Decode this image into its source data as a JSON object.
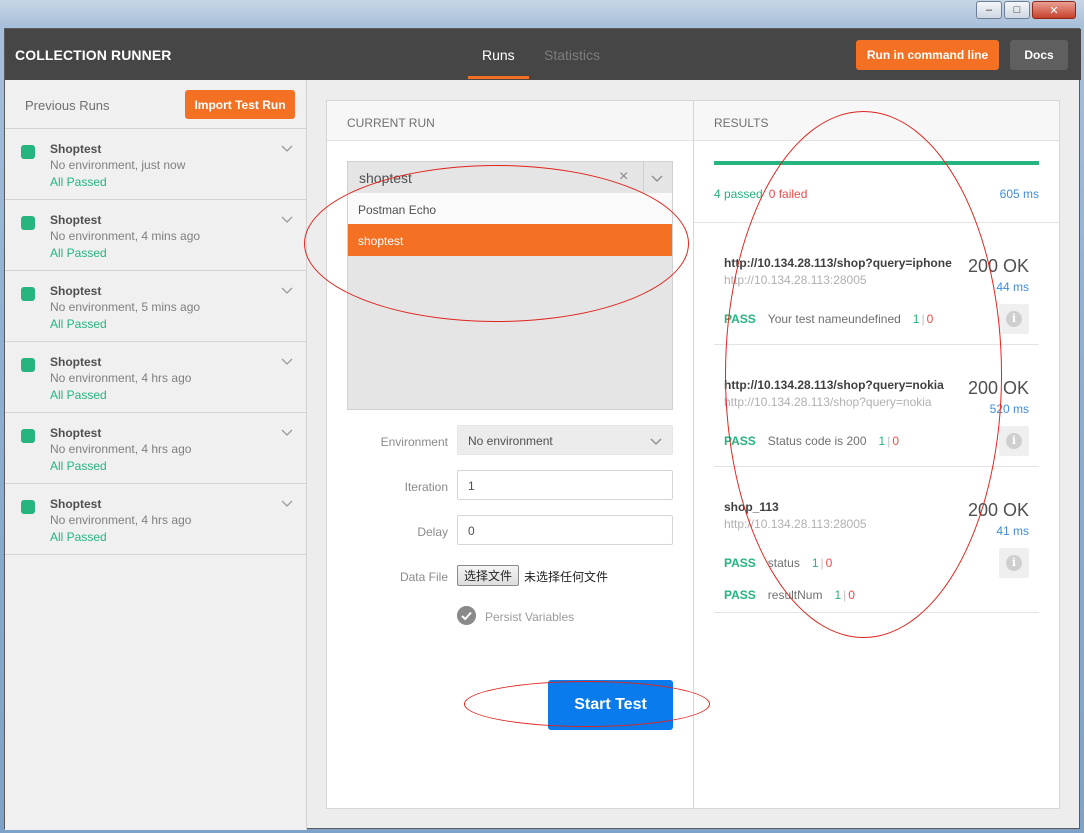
{
  "header": {
    "app_title": "COLLECTION RUNNER",
    "tabs": [
      {
        "label": "Runs",
        "active": true
      },
      {
        "label": "Statistics",
        "active": false
      }
    ],
    "run_cmd_label": "Run in command line",
    "docs_label": "Docs"
  },
  "sidebar": {
    "title": "Previous Runs",
    "import_label": "Import Test Run",
    "runs": [
      {
        "name": "Shoptest",
        "env": "No environment, just now",
        "result": "All Passed"
      },
      {
        "name": "Shoptest",
        "env": "No environment, 4 mins ago",
        "result": "All Passed"
      },
      {
        "name": "Shoptest",
        "env": "No environment, 5 mins ago",
        "result": "All Passed"
      },
      {
        "name": "Shoptest",
        "env": "No environment, 4 hrs ago",
        "result": "All Passed"
      },
      {
        "name": "Shoptest",
        "env": "No environment, 4 hrs ago",
        "result": "All Passed"
      },
      {
        "name": "Shoptest",
        "env": "No environment, 4 hrs ago",
        "result": "All Passed"
      }
    ]
  },
  "current_run": {
    "heading": "CURRENT RUN",
    "collection_value": "shoptest",
    "collection_options": [
      "Postman Echo",
      "shoptest"
    ],
    "environment_label": "Environment",
    "environment_value": "No environment",
    "iteration_label": "Iteration",
    "iteration_value": "1",
    "delay_label": "Delay",
    "delay_value": "0",
    "datafile_label": "Data File",
    "datafile_button": "选择文件",
    "datafile_note": "未选择任何文件",
    "persist_label": "Persist Variables",
    "start_label": "Start Test"
  },
  "results": {
    "heading": "RESULTS",
    "passed": "4 passed",
    "failed": "0 failed",
    "total_time": "605 ms",
    "progress_fraction": 1.0,
    "requests": [
      {
        "name": "http://10.134.28.113/shop?query=iphone",
        "sub": "http://10.134.28.113:28005",
        "code": "200 OK",
        "time": "44 ms",
        "tests": [
          {
            "status": "PASS",
            "name": "Your test nameundefined",
            "pass": "1",
            "fail": "0"
          }
        ]
      },
      {
        "name": "http://10.134.28.113/shop?query=nokia",
        "sub": "http://10.134.28.113/shop?query=nokia",
        "code": "200 OK",
        "time": "520 ms",
        "tests": [
          {
            "status": "PASS",
            "name": "Status code is 200",
            "pass": "1",
            "fail": "0"
          }
        ]
      },
      {
        "name": "shop_113",
        "sub": "http://10.134.28.113:28005",
        "code": "200 OK",
        "time": "41 ms",
        "tests": [
          {
            "status": "PASS",
            "name": "status",
            "pass": "1",
            "fail": "0"
          },
          {
            "status": "PASS",
            "name": "resultNum",
            "pass": "1",
            "fail": "0"
          }
        ]
      }
    ]
  },
  "colors": {
    "accent_orange": "#f47023",
    "success_green": "#26b47f",
    "fail_red": "#ed4b48",
    "link_blue": "#3f8ddb",
    "start_blue": "#097bed",
    "annotation_red": "#e0241c"
  },
  "icons": {
    "run_status": "status-square-icon",
    "chevron": "chevron-down-icon",
    "clear": "close-icon",
    "persist": "check-circle-icon",
    "info": "info-icon"
  }
}
